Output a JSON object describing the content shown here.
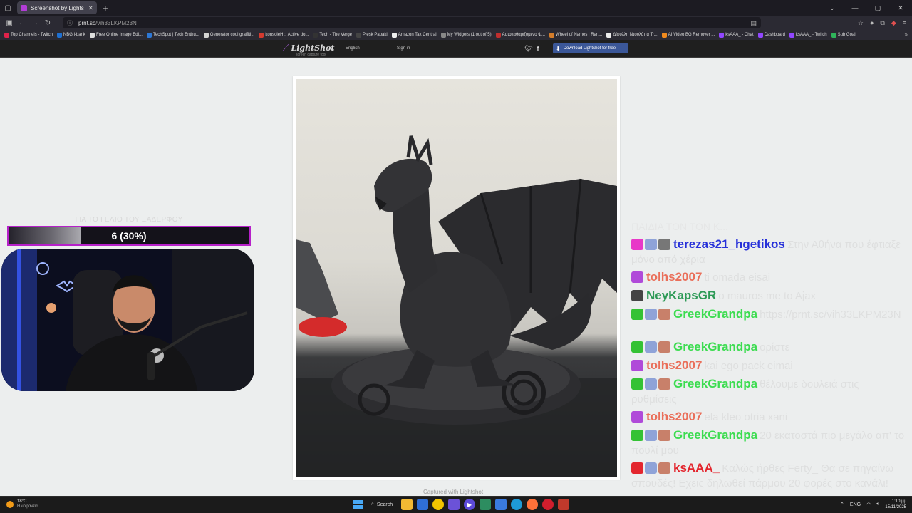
{
  "browser": {
    "tab_title": "Screenshot by Lightshot",
    "url_host": "prnt.sc",
    "url_path": "/vih33LKPM23N",
    "bookmarks": [
      {
        "label": "Top Channels - Twitch",
        "color": "#e0224a"
      },
      {
        "label": "NBG i-bank",
        "color": "#1e6fd1"
      },
      {
        "label": "Free Online Image Edi...",
        "color": "#dddddd"
      },
      {
        "label": "TechSpot | Tech Enthu...",
        "color": "#2d77d6"
      },
      {
        "label": "Generator cool graffiti...",
        "color": "#d5d5d5"
      },
      {
        "label": "konsoleH :: Active do...",
        "color": "#d43a2f"
      },
      {
        "label": "Tech - The Verge",
        "color": "#333333"
      },
      {
        "label": "Plesk Papaki",
        "color": "#444444"
      },
      {
        "label": "Amazon Tax Central",
        "color": "#eeeeee"
      },
      {
        "label": "My Widgets (1 out of 5)",
        "color": "#888888"
      },
      {
        "label": "Αυτοκαθαριζόμενο Φ...",
        "color": "#c02e2e"
      },
      {
        "label": "Wheel of Names | Ran...",
        "color": "#d47d2b"
      },
      {
        "label": "Δίφυλλη Ντουλάπα Tr...",
        "color": "#eeeeee"
      },
      {
        "label": "AI Video BG Remover ...",
        "color": "#f08a1e"
      },
      {
        "label": "ksAAA_ - Chat",
        "color": "#9146ff"
      },
      {
        "label": "Dashboard",
        "color": "#9146ff"
      },
      {
        "label": "ksAAA_ - Twitch",
        "color": "#9146ff"
      },
      {
        "label": "Sub Goal",
        "color": "#2fb45a"
      }
    ]
  },
  "lightshot": {
    "logo": "LightShot",
    "tagline": "screen capture tool",
    "language": "English",
    "signin": "Sign in",
    "download": "Download Lightshot for free",
    "captured": "Captured with Lightshot"
  },
  "goal": {
    "title": "ΓΙΑ ΤΟ ΓΕΛΙΟ ΤΟΥ ΞΑΔΕΡΦΟΥ",
    "text": "6 (30%)",
    "progress": 0.3,
    "border_color": "#b620c9"
  },
  "chat": {
    "top_fragment": "ΠΑΙΔΙΑ ΤΟΝ ΤΟΝ Κ...",
    "messages": [
      {
        "user": "terezas21_hgetikos",
        "color": "#2630d9",
        "badges": [
          "#e838c8",
          "#8fa3d8",
          "#777777"
        ],
        "text": "Στην Αθήνα που έφτιαξε μόνο από χέρια"
      },
      {
        "user": "tolhs2007",
        "color": "#ea6f5a",
        "badges": [
          "#b04ad9"
        ],
        "text": "ti omada eisai"
      },
      {
        "user": "NeyKapsGR",
        "color": "#2e9a57",
        "badges": [
          "#444444"
        ],
        "text": "o mauros me to Ajax"
      },
      {
        "user": "GreekGrandpa",
        "color": "#3cdc50",
        "badges": [
          "#34c234",
          "#8fa3d8",
          "#c8806a"
        ],
        "text": "https://prnt.sc/vih33LKPM23N"
      },
      {
        "user": "GreekGrandpa",
        "color": "#3cdc50",
        "badges": [
          "#34c234",
          "#8fa3d8",
          "#c8806a"
        ],
        "text": "ορίστε"
      },
      {
        "user": "tolhs2007",
        "color": "#ea6f5a",
        "badges": [
          "#b04ad9"
        ],
        "text": "kai ego pack eimai"
      },
      {
        "user": "GreekGrandpa",
        "color": "#3cdc50",
        "badges": [
          "#34c234",
          "#8fa3d8",
          "#c8806a"
        ],
        "text": "θέλουμε δουλειά στις ρυθμίσεις"
      },
      {
        "user": "tolhs2007",
        "color": "#ea6f5a",
        "badges": [
          "#b04ad9"
        ],
        "text": "ela kleo otria xani"
      },
      {
        "user": "GreekGrandpa",
        "color": "#3cdc50",
        "badges": [
          "#34c234",
          "#8fa3d8",
          "#c8806a"
        ],
        "text": "20 εκατοστά πιο μεγάλο απ' το πουλί μου"
      },
      {
        "user": "ksAAA_",
        "color": "#e3262e",
        "badges": [
          "#e3262e",
          "#8fa3d8",
          "#c8806a"
        ],
        "text": "Καλώς ήρθες Ferty_ Θα σε πηγαίνω σπουδές! Εχεις δηλωθεί πάρμου 20 φορές στο κανάλι!"
      }
    ],
    "last_line": "κανάλι!"
  },
  "taskbar": {
    "temp": "18°C",
    "weather": "Ηλιοφάνεια",
    "search": "Search",
    "lang": "ENG",
    "time": "1:10 μμ",
    "date": "15/11/2025"
  }
}
